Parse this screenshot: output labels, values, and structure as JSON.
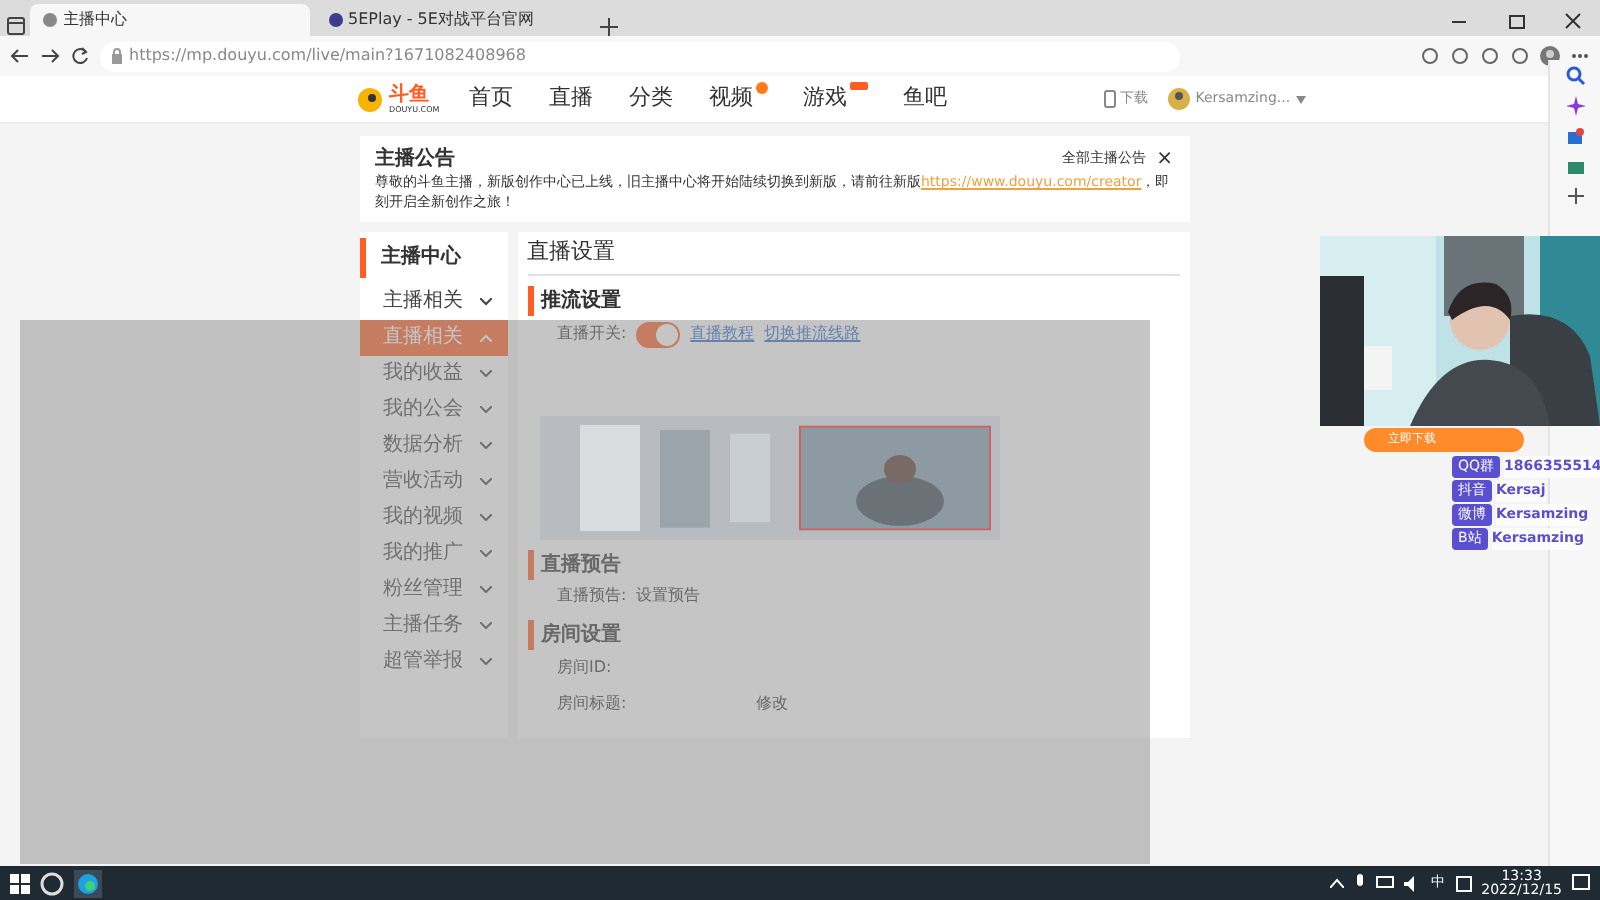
{
  "browser": {
    "tabs": [
      {
        "title": "主播中心",
        "selected": true
      },
      {
        "title": "5EPlay - 5E对战平台官网",
        "selected": false
      }
    ],
    "url": "https://mp.douyu.com/live/main?1671082408968"
  },
  "site_header": {
    "logo": "斗鱼",
    "logo_sub": "DOUYU.COM",
    "nav": [
      {
        "label": "首页",
        "new_dot": false,
        "hot_tag": false
      },
      {
        "label": "直播",
        "new_dot": false,
        "hot_tag": false
      },
      {
        "label": "分类",
        "new_dot": false,
        "hot_tag": false
      },
      {
        "label": "视频",
        "new_dot": true,
        "hot_tag": false
      },
      {
        "label": "游戏",
        "new_dot": false,
        "hot_tag": true
      },
      {
        "label": "鱼吧",
        "new_dot": false,
        "hot_tag": false
      }
    ],
    "download": "下载",
    "user": "Kersamzing..."
  },
  "announcement": {
    "title": "主播公告",
    "text": "尊敬的斗鱼主播，新版创作中心已上线，旧主播中心将开始陆续切换到新版，请前往新版",
    "link": "https://www.douyu.com/creator",
    "text_after": "，即刻开启全新创作之旅！",
    "all_link": "全部主播公告",
    "close": "×"
  },
  "sidebar": {
    "title": "主播中心",
    "items": [
      {
        "label": "主播相关",
        "selected": false,
        "expanded": false
      },
      {
        "label": "直播相关",
        "selected": true,
        "expanded": true
      },
      {
        "label": "我的收益",
        "selected": false,
        "expanded": false
      },
      {
        "label": "我的公会",
        "selected": false,
        "expanded": false
      },
      {
        "label": "数据分析",
        "selected": false,
        "expanded": false
      },
      {
        "label": "营收活动",
        "selected": false,
        "expanded": false
      },
      {
        "label": "我的视频",
        "selected": false,
        "expanded": false
      },
      {
        "label": "我的推广",
        "selected": false,
        "expanded": false
      },
      {
        "label": "粉丝管理",
        "selected": false,
        "expanded": false
      },
      {
        "label": "主播任务",
        "selected": false,
        "expanded": false
      },
      {
        "label": "超管举报",
        "selected": false,
        "expanded": false
      }
    ]
  },
  "main": {
    "title": "直播设置",
    "sections": [
      {
        "heading": "推流设置",
        "rows": [
          {
            "kind": "switch",
            "label": "直播开关:",
            "on": true,
            "links": [
              "直播教程",
              "切换推流线路"
            ]
          }
        ]
      },
      {
        "heading": "直播预告",
        "rows": [
          {
            "kind": "link",
            "label": "直播预告:",
            "value": "设置预告"
          }
        ]
      },
      {
        "heading": "房间设置",
        "rows": [
          {
            "kind": "text",
            "label": "房间ID:"
          },
          {
            "kind": "edit",
            "label": "房间标题:",
            "value": "修改"
          }
        ]
      }
    ]
  },
  "webcam": {
    "socials": [
      {
        "platform": "QQ群",
        "handle": "1866355514"
      },
      {
        "platform": "抖音",
        "handle": "Kersaj"
      },
      {
        "platform": "微博",
        "handle": "Kersamzing"
      },
      {
        "platform": "B站",
        "handle": "Kersamzing"
      }
    ],
    "pill": "立即下载"
  },
  "taskbar": {
    "time": "13:33",
    "date": "2022/12/15",
    "ime": "中"
  }
}
